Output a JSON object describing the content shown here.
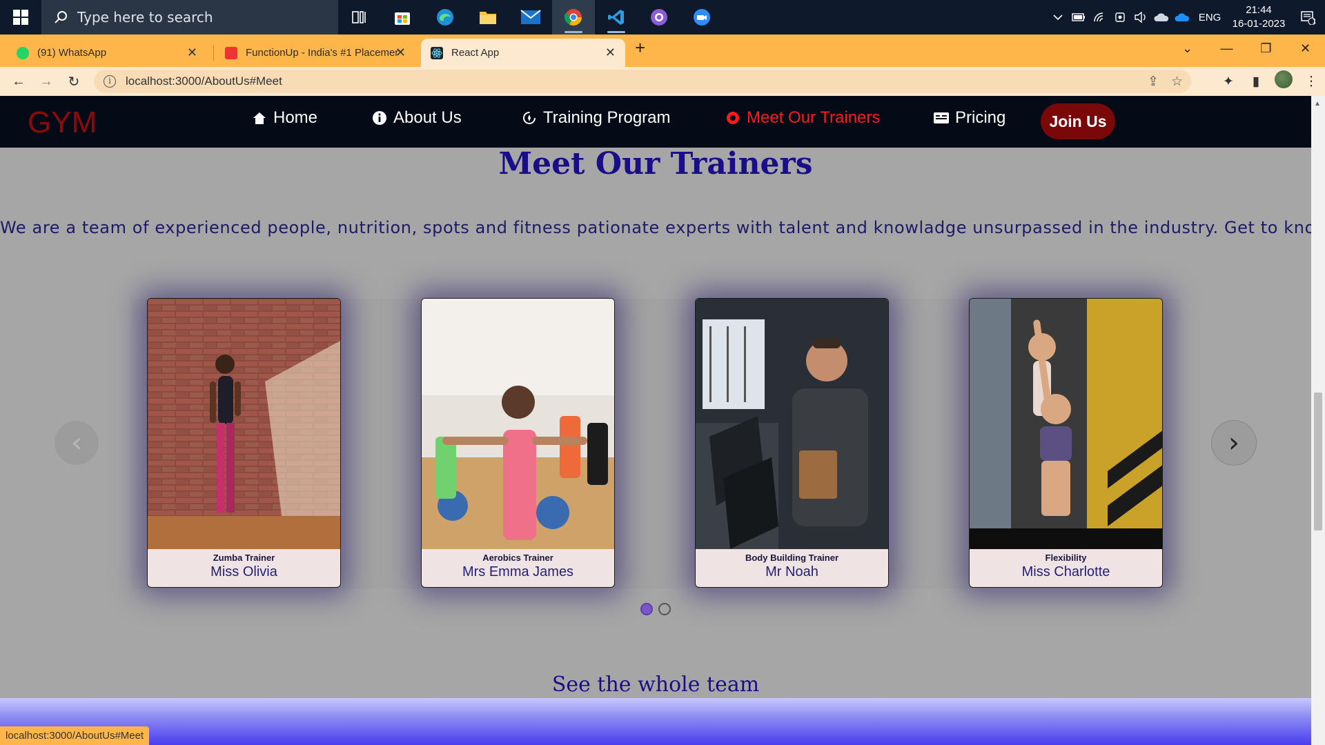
{
  "taskbar": {
    "search_placeholder": "Type here to search",
    "lang": "ENG",
    "time": "21:44",
    "date": "16-01-2023",
    "notif_count": "1"
  },
  "browser": {
    "tabs": [
      {
        "label": "(91) WhatsApp"
      },
      {
        "label": "FunctionUp - India's #1 Placemen"
      },
      {
        "label": "React App"
      }
    ],
    "url": "localhost:3000/AboutUs#Meet",
    "status_url": "localhost:3000/AboutUs#Meet"
  },
  "site": {
    "logo": "GYM",
    "nav": [
      {
        "label": "Home",
        "icon": "home-icon"
      },
      {
        "label": "About Us",
        "icon": "info-icon"
      },
      {
        "label": "Training Program",
        "icon": "training-icon"
      },
      {
        "label": "Meet Our Trainers",
        "icon": "trainer-icon"
      },
      {
        "label": "Pricing",
        "icon": "pricing-icon"
      }
    ],
    "join_label": "Join Us",
    "accent": "#ff1a1a"
  },
  "section": {
    "title": "Meet Our Trainers",
    "description": "We are a team of experienced people, nutrition, spots and fitness pationate experts with talent and knowladge unsurpassed in the industry. Get to know us.",
    "see_team": "See the whole team"
  },
  "trainers": [
    {
      "role": "Zumba Trainer",
      "name": "Miss Olivia"
    },
    {
      "role": "Aerobics Trainer",
      "name": "Mrs Emma James"
    },
    {
      "role": "Body Building Trainer",
      "name": "Mr Noah"
    },
    {
      "role": "Flexibility",
      "name": "Miss Charlotte"
    }
  ],
  "carousel": {
    "prev": "‹",
    "next": "›",
    "page": 1,
    "pages": 2
  }
}
